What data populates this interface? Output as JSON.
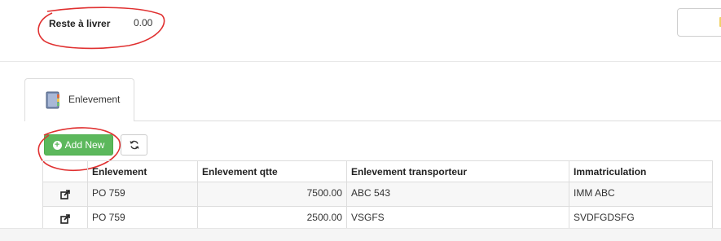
{
  "summary": {
    "label": "Reste à livrer",
    "value": "0.00"
  },
  "tab": {
    "label": "Enlevement",
    "icon": "notebook-icon"
  },
  "toolbar": {
    "add_label": "Add New",
    "add_icon": "plus-circle-icon",
    "refresh_icon": "refresh-icon"
  },
  "table": {
    "headers": [
      "",
      "Enlevement",
      "Enlevement qtte",
      "Enlevement transporteur",
      "Immatriculation"
    ],
    "rows": [
      {
        "action_icon": "external-link-icon",
        "enlevement": "PO 759",
        "qtte": "7500.00",
        "transporteur": "ABC 543",
        "immatriculation": "IMM ABC"
      },
      {
        "action_icon": "external-link-icon",
        "enlevement": "PO 759",
        "qtte": "2500.00",
        "transporteur": "VSGFS",
        "immatriculation": "SVDFGDSFG"
      }
    ]
  },
  "colors": {
    "add_button": "#5cb85c",
    "annotation": "#e03030"
  }
}
